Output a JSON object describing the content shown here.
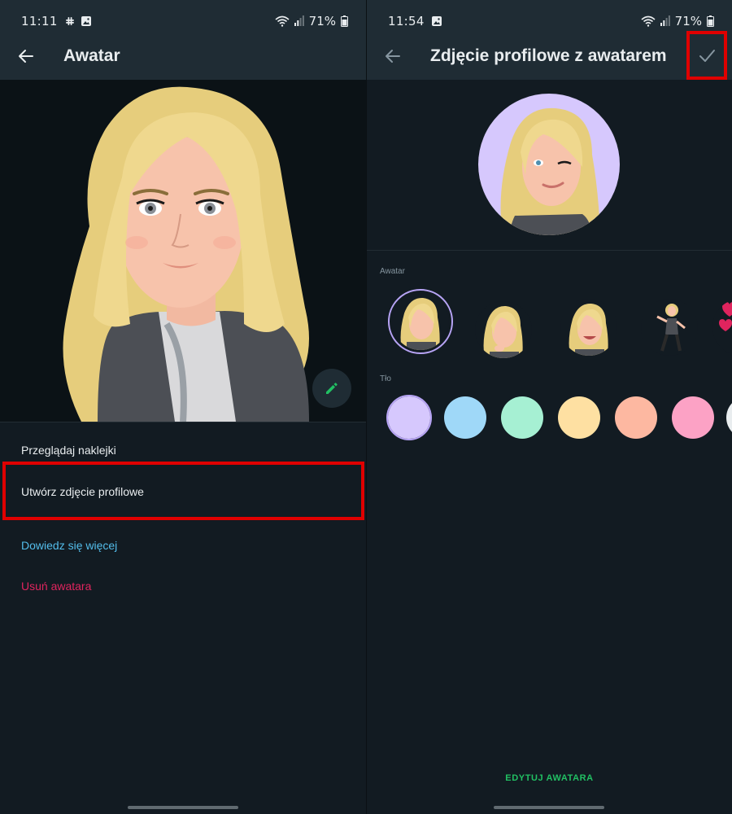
{
  "left": {
    "status": {
      "time": "11:11",
      "battery": "71%"
    },
    "title": "Awatar",
    "menu": {
      "browse_stickers": "Przeglądaj naklejki",
      "create_profile_photo": "Utwórz zdjęcie profilowe",
      "learn_more": "Dowiedz się więcej",
      "delete_avatar": "Usuń awatara"
    }
  },
  "right": {
    "status": {
      "time": "11:54",
      "battery": "71%"
    },
    "title": "Zdjęcie profilowe z awatarem",
    "avatar_label": "Awatar",
    "background_label": "Tło",
    "edit_avatar": "EDYTUJ AWATARA",
    "background_colors": [
      "#d6c8fd",
      "#9fd8f8",
      "#a6f0d3",
      "#fee0a2",
      "#fdb8a1",
      "#fca2c5"
    ]
  },
  "colors": {
    "accent_green": "#21c063",
    "link_blue": "#53bdeb",
    "danger_red": "#e0245e",
    "highlight_red": "#e00000"
  }
}
